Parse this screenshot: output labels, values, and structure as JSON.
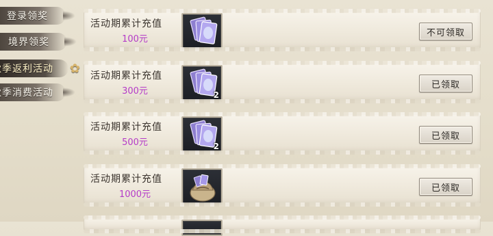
{
  "nav": {
    "items": [
      {
        "label": "登录领奖",
        "active": false
      },
      {
        "label": "境界领奖",
        "active": false
      },
      {
        "label": "秋季返利活动",
        "active": true
      },
      {
        "label": "秋季消费活动",
        "active": false
      }
    ]
  },
  "rewards": [
    {
      "title": "活动期累计充值",
      "amount": "100元",
      "item_icon": "purple-card-stack-icon",
      "quantity": "",
      "button": "不可领取"
    },
    {
      "title": "活动期累计充值",
      "amount": "300元",
      "item_icon": "purple-card-stack-icon",
      "quantity": "2",
      "button": "已领取"
    },
    {
      "title": "活动期累计充值",
      "amount": "500元",
      "item_icon": "purple-card-stack-icon",
      "quantity": "2",
      "button": "已领取"
    },
    {
      "title": "活动期累计充值",
      "amount": "1000元",
      "item_icon": "treasure-pouch-icon",
      "quantity": "",
      "button": "已领取"
    }
  ],
  "colors": {
    "amount": "#b43ac8",
    "background": "#e6e0cf",
    "nav_bg": "#463e37"
  }
}
